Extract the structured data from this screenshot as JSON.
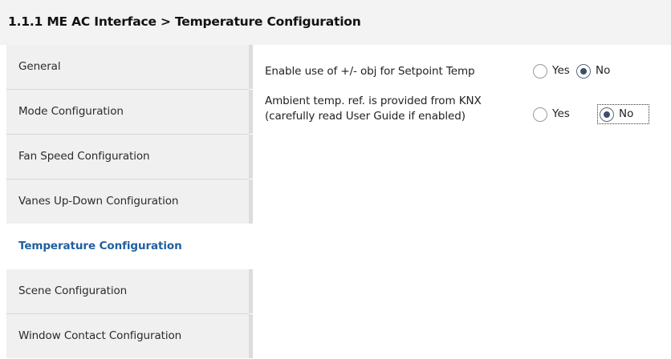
{
  "header": {
    "title": "1.1.1 ME AC Interface > Temperature Configuration"
  },
  "sidebar": {
    "items": [
      {
        "label": "General"
      },
      {
        "label": "Mode Configuration"
      },
      {
        "label": "Fan Speed Configuration"
      },
      {
        "label": "Vanes Up-Down Configuration"
      },
      {
        "label": "Temperature Configuration",
        "active": true
      },
      {
        "label": "Scene Configuration"
      },
      {
        "label": "Window Contact Configuration"
      }
    ]
  },
  "params": [
    {
      "label": "Enable use of +/- obj for Setpoint Temp",
      "options": [
        "Yes",
        "No"
      ],
      "selected": "No"
    },
    {
      "label_line1": "Ambient temp. ref. is provided from KNX",
      "label_line2": "(carefully read User Guide if enabled)",
      "options": [
        "Yes",
        "No"
      ],
      "selected": "No",
      "focused": "No"
    }
  ],
  "colors": {
    "header_bg": "#f3f3f3",
    "nav_bg": "#f0f0f0",
    "active_text": "#1f5f9e",
    "radio_checked": "#3d4f68"
  }
}
